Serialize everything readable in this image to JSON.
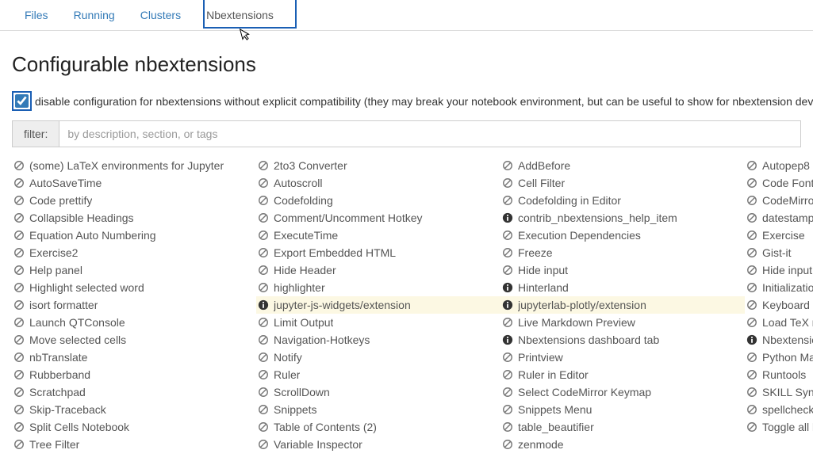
{
  "tabs": [
    {
      "label": "Files"
    },
    {
      "label": "Running"
    },
    {
      "label": "Clusters"
    },
    {
      "label": "Nbextensions"
    }
  ],
  "page_title": "Configurable nbextensions",
  "compat_label": "disable configuration for nbextensions without explicit compatibility (they may break your notebook environment, but can be useful to show for nbextension develo",
  "filter": {
    "label": "filter:",
    "placeholder": "by description, section, or tags"
  },
  "extensions": [
    {
      "icon": "disabled",
      "label": "(some) LaTeX environments for Jupyter",
      "hl": false
    },
    {
      "icon": "disabled",
      "label": "2to3 Converter",
      "hl": false
    },
    {
      "icon": "disabled",
      "label": "AddBefore",
      "hl": false
    },
    {
      "icon": "disabled",
      "label": "Autopep8",
      "hl": false
    },
    {
      "icon": "disabled",
      "label": "AutoSaveTime",
      "hl": false
    },
    {
      "icon": "disabled",
      "label": "Autoscroll",
      "hl": false
    },
    {
      "icon": "disabled",
      "label": "Cell Filter",
      "hl": false
    },
    {
      "icon": "disabled",
      "label": "Code Font S",
      "hl": false
    },
    {
      "icon": "disabled",
      "label": "Code prettify",
      "hl": false
    },
    {
      "icon": "disabled",
      "label": "Codefolding",
      "hl": false
    },
    {
      "icon": "disabled",
      "label": "Codefolding in Editor",
      "hl": false
    },
    {
      "icon": "disabled",
      "label": "CodeMirror",
      "hl": false
    },
    {
      "icon": "disabled",
      "label": "Collapsible Headings",
      "hl": false
    },
    {
      "icon": "disabled",
      "label": "Comment/Uncomment Hotkey",
      "hl": false
    },
    {
      "icon": "info",
      "label": "contrib_nbextensions_help_item",
      "hl": false
    },
    {
      "icon": "disabled",
      "label": "datestampe",
      "hl": false
    },
    {
      "icon": "disabled",
      "label": "Equation Auto Numbering",
      "hl": false
    },
    {
      "icon": "disabled",
      "label": "ExecuteTime",
      "hl": false
    },
    {
      "icon": "disabled",
      "label": "Execution Dependencies",
      "hl": false
    },
    {
      "icon": "disabled",
      "label": "Exercise",
      "hl": false
    },
    {
      "icon": "disabled",
      "label": "Exercise2",
      "hl": false
    },
    {
      "icon": "disabled",
      "label": "Export Embedded HTML",
      "hl": false
    },
    {
      "icon": "disabled",
      "label": "Freeze",
      "hl": false
    },
    {
      "icon": "disabled",
      "label": "Gist-it",
      "hl": false
    },
    {
      "icon": "disabled",
      "label": "Help panel",
      "hl": false
    },
    {
      "icon": "disabled",
      "label": "Hide Header",
      "hl": false
    },
    {
      "icon": "disabled",
      "label": "Hide input",
      "hl": false
    },
    {
      "icon": "disabled",
      "label": "Hide input a",
      "hl": false
    },
    {
      "icon": "disabled",
      "label": "Highlight selected word",
      "hl": false
    },
    {
      "icon": "disabled",
      "label": "highlighter",
      "hl": false
    },
    {
      "icon": "info",
      "label": "Hinterland",
      "hl": false
    },
    {
      "icon": "disabled",
      "label": "Initialization",
      "hl": false
    },
    {
      "icon": "disabled",
      "label": "isort formatter",
      "hl": false
    },
    {
      "icon": "info",
      "label": "jupyter-js-widgets/extension",
      "hl": true
    },
    {
      "icon": "info",
      "label": "jupyterlab-plotly/extension",
      "hl": true
    },
    {
      "icon": "disabled",
      "label": "Keyboard s",
      "hl": false
    },
    {
      "icon": "disabled",
      "label": "Launch QTConsole",
      "hl": false
    },
    {
      "icon": "disabled",
      "label": "Limit Output",
      "hl": false
    },
    {
      "icon": "disabled",
      "label": "Live Markdown Preview",
      "hl": false
    },
    {
      "icon": "disabled",
      "label": "Load TeX m",
      "hl": false
    },
    {
      "icon": "disabled",
      "label": "Move selected cells",
      "hl": false
    },
    {
      "icon": "disabled",
      "label": "Navigation-Hotkeys",
      "hl": false
    },
    {
      "icon": "info",
      "label": "Nbextensions dashboard tab",
      "hl": false
    },
    {
      "icon": "info",
      "label": "Nbextension",
      "hl": false
    },
    {
      "icon": "disabled",
      "label": "nbTranslate",
      "hl": false
    },
    {
      "icon": "disabled",
      "label": "Notify",
      "hl": false
    },
    {
      "icon": "disabled",
      "label": "Printview",
      "hl": false
    },
    {
      "icon": "disabled",
      "label": "Python Mar",
      "hl": false
    },
    {
      "icon": "disabled",
      "label": "Rubberband",
      "hl": false
    },
    {
      "icon": "disabled",
      "label": "Ruler",
      "hl": false
    },
    {
      "icon": "disabled",
      "label": "Ruler in Editor",
      "hl": false
    },
    {
      "icon": "disabled",
      "label": "Runtools",
      "hl": false
    },
    {
      "icon": "disabled",
      "label": "Scratchpad",
      "hl": false
    },
    {
      "icon": "disabled",
      "label": "ScrollDown",
      "hl": false
    },
    {
      "icon": "disabled",
      "label": "Select CodeMirror Keymap",
      "hl": false
    },
    {
      "icon": "disabled",
      "label": "SKILL Synt",
      "hl": false
    },
    {
      "icon": "disabled",
      "label": "Skip-Traceback",
      "hl": false
    },
    {
      "icon": "disabled",
      "label": "Snippets",
      "hl": false
    },
    {
      "icon": "disabled",
      "label": "Snippets Menu",
      "hl": false
    },
    {
      "icon": "disabled",
      "label": "spellchecke",
      "hl": false
    },
    {
      "icon": "disabled",
      "label": "Split Cells Notebook",
      "hl": false
    },
    {
      "icon": "disabled",
      "label": "Table of Contents (2)",
      "hl": false
    },
    {
      "icon": "disabled",
      "label": "table_beautifier",
      "hl": false
    },
    {
      "icon": "disabled",
      "label": "Toggle all li",
      "hl": false
    },
    {
      "icon": "disabled",
      "label": "Tree Filter",
      "hl": false
    },
    {
      "icon": "disabled",
      "label": "Variable Inspector",
      "hl": false
    },
    {
      "icon": "disabled",
      "label": "zenmode",
      "hl": false
    }
  ]
}
